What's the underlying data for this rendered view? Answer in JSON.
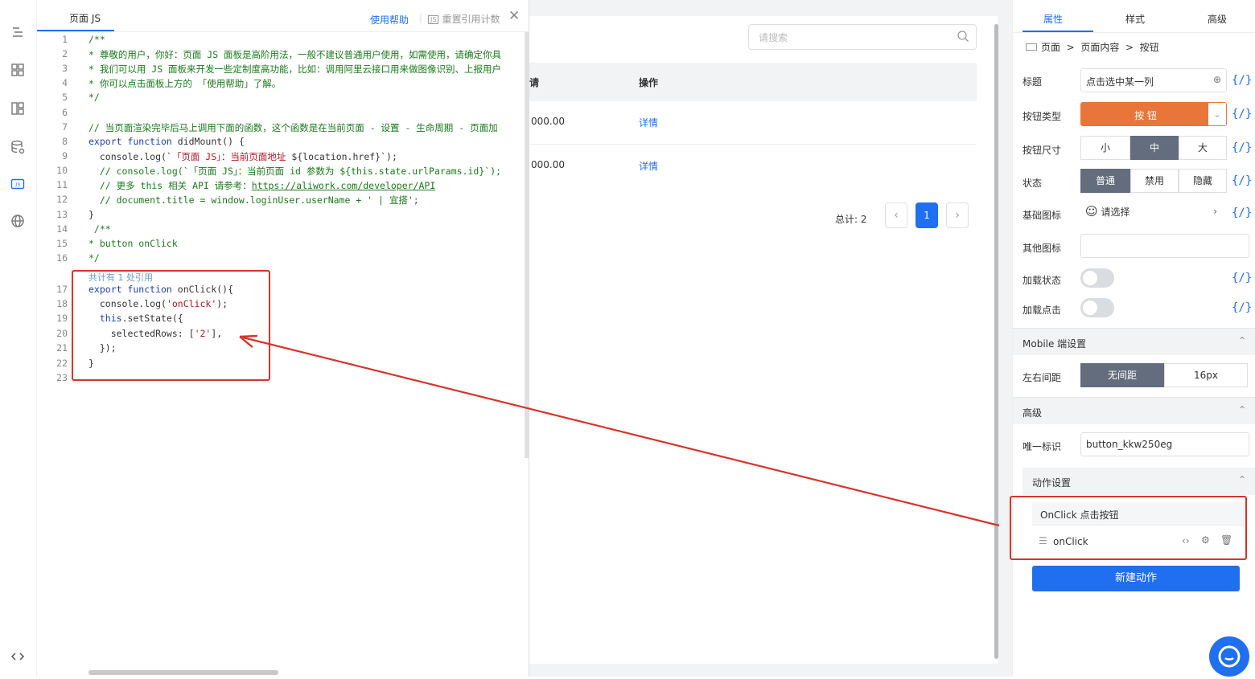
{
  "code_panel": {
    "tab_title": "页面 JS",
    "help_link": "使用帮助",
    "reset_label": "重置引用计数",
    "reference_hint": "共计有 1 处引用",
    "line_numbers": [
      "1",
      "2",
      "3",
      "4",
      "5",
      "6",
      "7",
      "8",
      "9",
      "10",
      "11",
      "12",
      "13",
      "14",
      "15",
      "16",
      "17",
      "18",
      "19",
      "20",
      "21",
      "22",
      "23"
    ]
  },
  "middle": {
    "search_placeholder": "请搜索",
    "header_partial": "请",
    "operation_header": "操作",
    "rows": [
      {
        "amount": "000.00",
        "action": "详情"
      },
      {
        "amount": "000.00",
        "action": "详情"
      }
    ],
    "total": "总计: 2",
    "page": "1"
  },
  "props": {
    "tabs": [
      "属性",
      "样式",
      "高级"
    ],
    "breadcrumb": "页面  >  页面内容  >  按钮",
    "title_label": "标题",
    "title_value": "点击选中某一列",
    "button_type_label": "按钮类型",
    "button_type_value": "按 钮",
    "size_label": "按钮尺寸",
    "sizes": [
      "小",
      "中",
      "大"
    ],
    "state_label": "状态",
    "states": [
      "普通",
      "禁用",
      "隐藏"
    ],
    "base_icon_label": "基础图标",
    "base_icon_value": "请选择",
    "other_icon_label": "其他图标",
    "loading_label": "加载状态",
    "loading_click_label": "加载点击",
    "mobile_section": "Mobile 端设置",
    "margin_label": "左右间距",
    "margins": [
      "无间距",
      "16px"
    ],
    "advanced_section": "高级",
    "id_label": "唯一标识",
    "id_value": "button_kkw250eg",
    "action_section": "动作设置",
    "action_event": "OnClick 点击按钮",
    "action_name": "onClick",
    "new_action": "新建动作",
    "expr_symbol": "{/}"
  },
  "colors": {
    "accent": "#1f6ff0",
    "button_orange": "#e8763a",
    "annotation_red": "#d6342a"
  }
}
